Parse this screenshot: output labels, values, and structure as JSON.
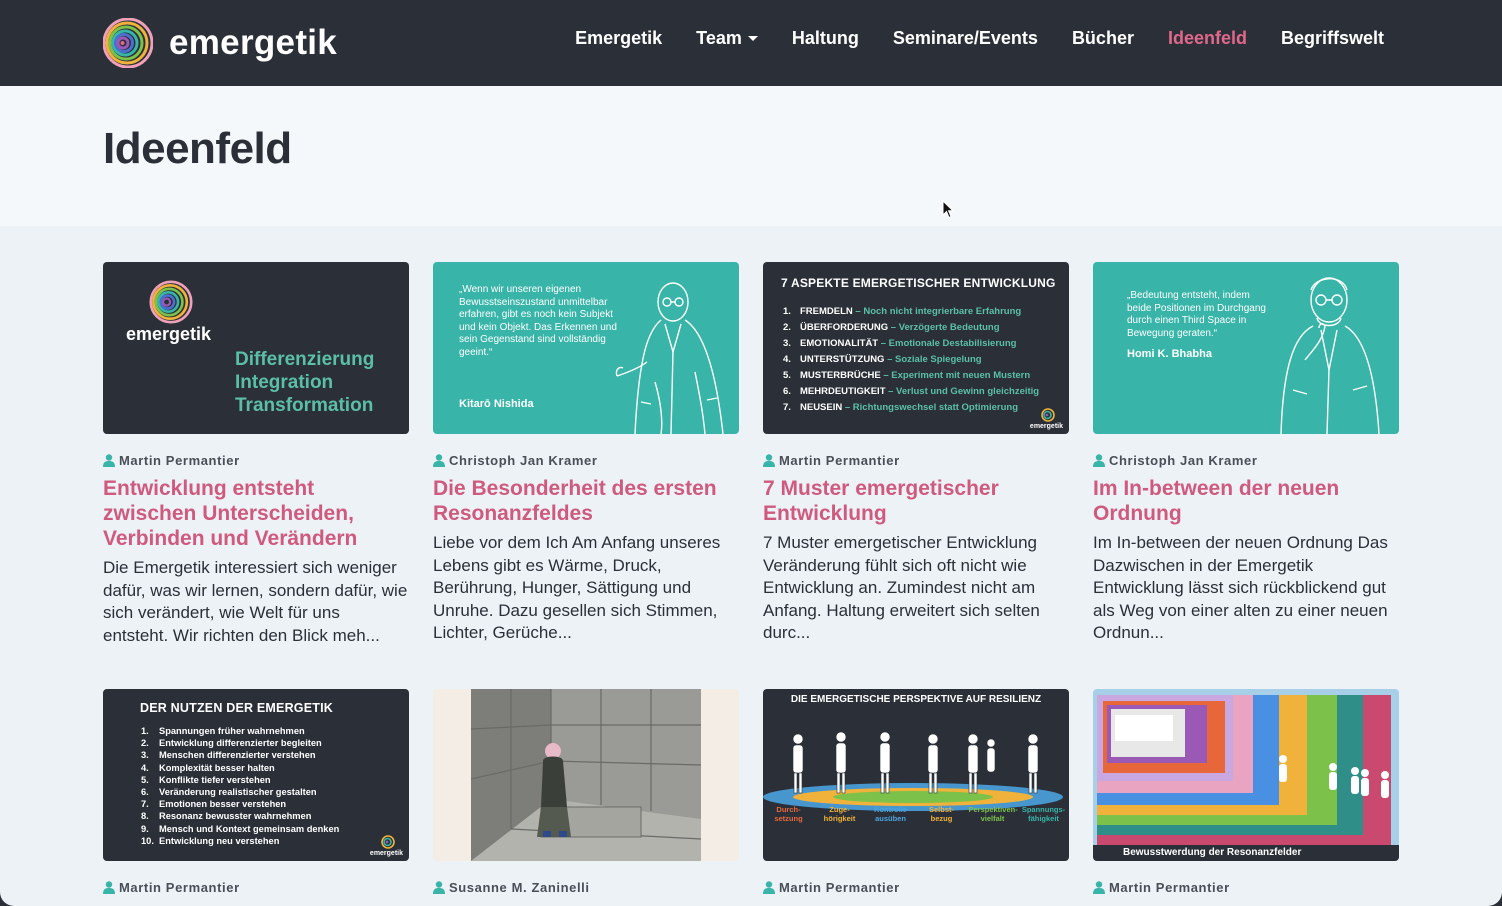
{
  "brand": {
    "name": "emergetik"
  },
  "nav": {
    "items": [
      {
        "label": "Emergetik"
      },
      {
        "label": "Team"
      },
      {
        "label": "Haltung"
      },
      {
        "label": "Seminare/Events"
      },
      {
        "label": "Bücher"
      },
      {
        "label": "Ideenfeld"
      },
      {
        "label": "Begriffswelt"
      }
    ],
    "active": "Ideenfeld",
    "active_color": "#e0688a"
  },
  "page": {
    "title": "Ideenfeld"
  },
  "colors": {
    "nav_bg": "#2b3038",
    "accent_pink": "#cf5a7e",
    "teal": "#38b5a8",
    "green": "#5bbfa6"
  },
  "cards": [
    {
      "author": "Martin Permantier",
      "title": "Entwicklung entsteht zwischen Unterscheiden, Verbinden und Verändern",
      "excerpt": "Die Emergetik interessiert sich weniger dafür, was wir lernen, sondern dafür, wie sich verändert, wie Welt für uns entsteht. Wir richten den Blick meh...",
      "thumb": {
        "brand": "emergetik",
        "lines": [
          "Differenzierung",
          "Integration",
          "Transformation"
        ]
      }
    },
    {
      "author": "Christoph Jan Kramer",
      "title": "Die Besonderheit des ersten Resonanzfeldes",
      "excerpt": "Liebe vor dem Ich Am Anfang unseres Lebens gibt es Wärme, Druck, Berührung, Hunger, Sättigung und Unruhe. Dazu gesellen sich Stimmen, Lichter, Gerüche...",
      "thumb": {
        "quote": "„Wenn wir unseren eigenen Bewusstseinszustand unmittelbar erfahren, gibt es noch kein Subjekt und kein Objekt. Das Erkennen und sein Gegenstand sind vollständig geeint.“",
        "quote_author": "Kitarō Nishida"
      }
    },
    {
      "author": "Martin Permantier",
      "title": "7 Muster emergetischer Entwicklung",
      "excerpt": "7 Muster emergetischer Entwicklung Veränderung fühlt sich oft nicht wie Entwicklung an. Zumindest nicht am Anfang. Haltung erweitert sich selten durc...",
      "thumb": {
        "heading": "7 ASPEKTE EMERGETISCHER ENTWICKLUNG",
        "brand": "emergetik",
        "items": [
          {
            "n": "1.",
            "label": "FREMDELN",
            "desc": " – Noch nicht integrierbare Erfahrung"
          },
          {
            "n": "2.",
            "label": "ÜBERFORDERUNG",
            "desc": " – Verzögerte Bedeutung"
          },
          {
            "n": "3.",
            "label": "EMOTIONALITÄT",
            "desc": " – Emotionale Destabilisierung"
          },
          {
            "n": "4.",
            "label": "UNTERSTÜTZUNG",
            "desc": " – Soziale Spiegelung"
          },
          {
            "n": "5.",
            "label": "MUSTERBRÜCHE",
            "desc": " – Experiment mit neuen Mustern"
          },
          {
            "n": "6.",
            "label": "MEHRDEUTIGKEIT",
            "desc": " – Verlust und Gewinn gleichzeitig"
          },
          {
            "n": "7.",
            "label": "NEUSEIN",
            "desc": " – Richtungswechsel statt Optimierung"
          }
        ]
      }
    },
    {
      "author": "Christoph Jan Kramer",
      "title": "Im In-between der neuen Ordnung",
      "excerpt": "Im In-between der neuen Ordnung Das Dazwischen in der Emergetik Entwicklung lässt sich rückblickend gut als Weg von einer alten zu einer neuen Ordnun...",
      "thumb": {
        "quote": "„Bedeutung entsteht, indem beide Positionen im Durchgang durch einen Third Space in Bewegung geraten.“",
        "quote_author": "Homi K. Bhabha"
      }
    },
    {
      "author": "Martin Permantier",
      "thumb": {
        "heading": "DER NUTZEN DER EMERGETIK",
        "brand": "emergetik",
        "items": [
          {
            "n": "1.",
            "label": "Spannungen früher wahrnehmen"
          },
          {
            "n": "2.",
            "label": "Entwicklung differenzierter begleiten"
          },
          {
            "n": "3.",
            "label": "Menschen differenzierter verstehen"
          },
          {
            "n": "4.",
            "label": "Komplexität besser halten"
          },
          {
            "n": "5.",
            "label": "Konflikte tiefer verstehen"
          },
          {
            "n": "6.",
            "label": "Veränderung realistischer gestalten"
          },
          {
            "n": "7.",
            "label": "Emotionen besser verstehen"
          },
          {
            "n": "8.",
            "label": "Resonanz bewusster wahrnehmen"
          },
          {
            "n": "9.",
            "label": "Mensch und Kontext gemeinsam denken"
          },
          {
            "n": "10.",
            "label": "Entwicklung neu verstehen"
          }
        ]
      }
    },
    {
      "author": "Susanne M. Zaninelli"
    },
    {
      "author": "Martin Permantier",
      "thumb": {
        "heading": "DIE EMERGETISCHE PERSPEKTIVE AUF RESILIENZ",
        "columns": [
          {
            "label": "Durch-\nsetzung",
            "color": "#e8673a"
          },
          {
            "label": "Zuge-\nhörigkeit",
            "color": "#f0b23a"
          },
          {
            "label": "Kontrolle\nausüben",
            "color": "#4aa3df"
          },
          {
            "label": "Selbst-\nbezug",
            "color": "#f0b23a"
          },
          {
            "label": "Perspektiven-\nvielfalt",
            "color": "#7cc24a"
          },
          {
            "label": "Spannungs-\nfähigkeit",
            "color": "#38b5a8"
          }
        ]
      }
    },
    {
      "author": "Martin Permantier",
      "thumb": {
        "caption": "Bewusstwerdung der Resonanzfelder"
      }
    }
  ]
}
